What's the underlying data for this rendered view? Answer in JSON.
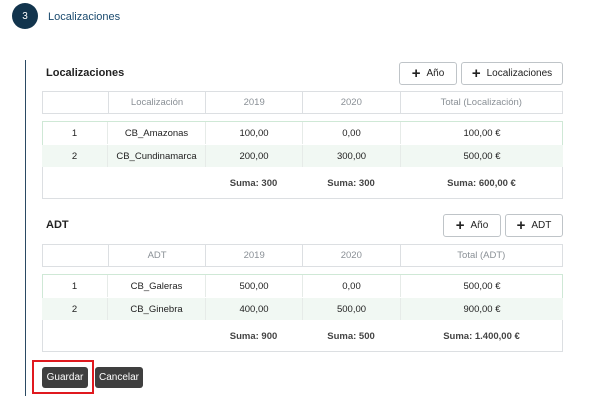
{
  "step": {
    "number": "3",
    "title": "Localizaciones"
  },
  "localizaciones": {
    "title": "Localizaciones",
    "buttons": {
      "add_year": "Año",
      "add_item": "Localizaciones"
    },
    "headers": [
      "",
      "Localización",
      "2019",
      "2020",
      "Total (Localización)"
    ],
    "rows": [
      [
        "1",
        "CB_Amazonas",
        "100,00",
        "0,00",
        "100,00 €"
      ],
      [
        "2",
        "CB_Cundinamarca",
        "200,00",
        "300,00",
        "500,00 €"
      ]
    ],
    "sums": [
      "",
      "",
      "Suma: 300",
      "Suma: 300",
      "Suma: 600,00 €"
    ]
  },
  "adt": {
    "title": "ADT",
    "buttons": {
      "add_year": "Año",
      "add_item": "ADT"
    },
    "headers": [
      "",
      "ADT",
      "2019",
      "2020",
      "Total (ADT)"
    ],
    "rows": [
      [
        "1",
        "CB_Galeras",
        "500,00",
        "0,00",
        "500,00 €"
      ],
      [
        "2",
        "CB_Ginebra",
        "400,00",
        "500,00",
        "900,00 €"
      ]
    ],
    "sums": [
      "",
      "",
      "Suma: 900",
      "Suma: 500",
      "Suma: 1.400,00 €"
    ]
  },
  "actions": {
    "save": "Guardar",
    "cancel": "Cancelar"
  },
  "colors": {
    "accent": "#12344d",
    "highlight": "#e0191f",
    "row_alt": "#f1f8f3"
  }
}
